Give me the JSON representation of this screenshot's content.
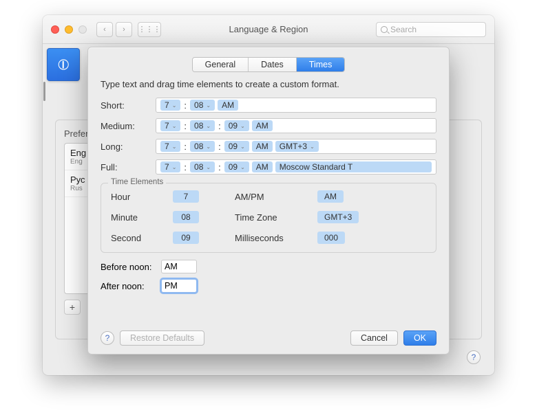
{
  "titlebar": {
    "title": "Language & Region",
    "search_placeholder": "Search"
  },
  "prefs": {
    "preferred_label": "Preferr",
    "languages": [
      {
        "title": "Eng",
        "sub": "Eng"
      },
      {
        "title": "Рус",
        "sub": "Rus"
      }
    ]
  },
  "sheet": {
    "tabs": [
      "General",
      "Dates",
      "Times"
    ],
    "active_tab": "Times",
    "instruction": "Type text and drag time elements to create a custom format.",
    "formats": {
      "short": {
        "label": "Short:",
        "hour": "7",
        "minute": "08",
        "ampm": "AM"
      },
      "medium": {
        "label": "Medium:",
        "hour": "7",
        "minute": "08",
        "second": "09",
        "ampm": "AM"
      },
      "long": {
        "label": "Long:",
        "hour": "7",
        "minute": "08",
        "second": "09",
        "ampm": "AM",
        "tz": "GMT+3"
      },
      "full": {
        "label": "Full:",
        "hour": "7",
        "minute": "08",
        "second": "09",
        "ampm": "AM",
        "tz": "Moscow Standard T"
      }
    },
    "time_elements": {
      "legend": "Time Elements",
      "hour_label": "Hour",
      "hour": "7",
      "minute_label": "Minute",
      "minute": "08",
      "second_label": "Second",
      "second": "09",
      "ampm_label": "AM/PM",
      "ampm": "AM",
      "tz_label": "Time Zone",
      "tz": "GMT+3",
      "ms_label": "Milliseconds",
      "ms": "000"
    },
    "noon": {
      "before_label": "Before noon:",
      "before_value": "AM",
      "after_label": "After noon:",
      "after_value": "PM"
    },
    "buttons": {
      "restore": "Restore Defaults",
      "cancel": "Cancel",
      "ok": "OK"
    }
  }
}
